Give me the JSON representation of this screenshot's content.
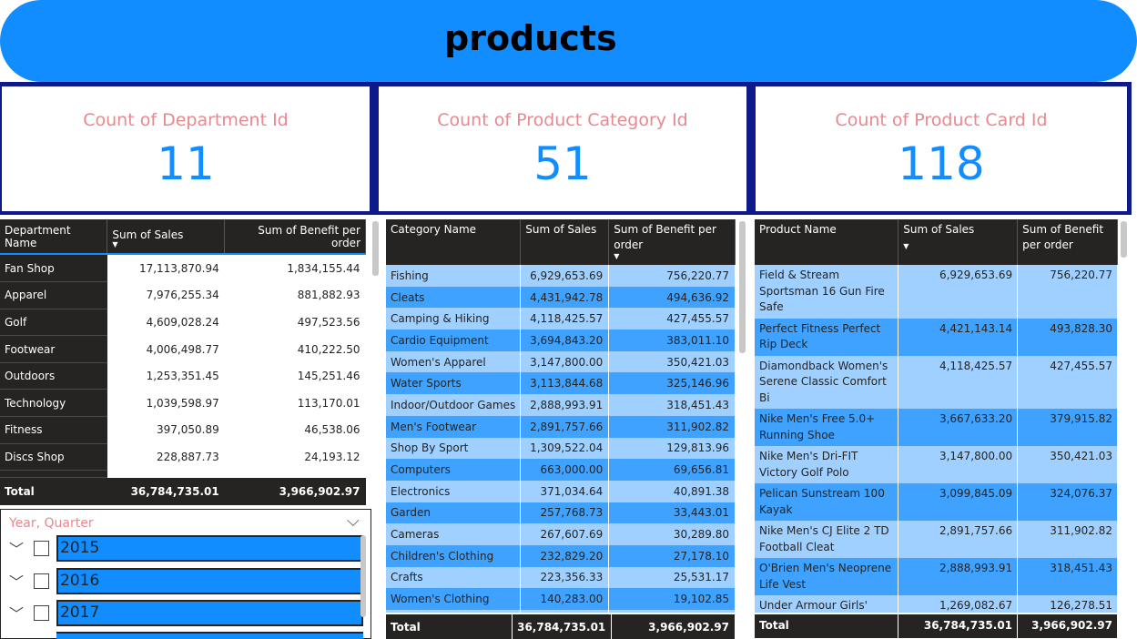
{
  "banner": {
    "title": "products"
  },
  "kpis": [
    {
      "label": "Count of Department Id",
      "value": "11"
    },
    {
      "label": "Count of Product Category Id",
      "value": "51"
    },
    {
      "label": "Count of Product Card Id",
      "value": "118"
    }
  ],
  "department_table": {
    "headers": [
      "Department Name",
      "Sum of Sales",
      "Sum of Benefit per order"
    ],
    "rows": [
      [
        "Fan Shop",
        "17,113,870.94",
        "1,834,155.44"
      ],
      [
        "Apparel",
        "7,976,255.34",
        "881,882.93"
      ],
      [
        "Golf",
        "4,609,028.24",
        "497,523.56"
      ],
      [
        "Footwear",
        "4,006,498.77",
        "410,222.50"
      ],
      [
        "Outdoors",
        "1,253,351.45",
        "145,251.46"
      ],
      [
        "Technology",
        "1,039,598.97",
        "113,170.01"
      ],
      [
        "Fitness",
        "397,050.89",
        "46,538.06"
      ],
      [
        "Discs Shop",
        "228,887.73",
        "24,193.12"
      ]
    ],
    "total": [
      "Total",
      "36,784,735.01",
      "3,966,902.97"
    ]
  },
  "category_table": {
    "headers": [
      "Category Name",
      "Sum of Sales",
      "Sum of Benefit per order"
    ],
    "rows": [
      [
        "Fishing",
        "6,929,653.69",
        "756,220.77"
      ],
      [
        "Cleats",
        "4,431,942.78",
        "494,636.92"
      ],
      [
        "Camping & Hiking",
        "4,118,425.57",
        "427,455.57"
      ],
      [
        "Cardio Equipment",
        "3,694,843.20",
        "383,011.10"
      ],
      [
        "Women's Apparel",
        "3,147,800.00",
        "350,421.03"
      ],
      [
        "Water Sports",
        "3,113,844.68",
        "325,146.96"
      ],
      [
        "Indoor/Outdoor Games",
        "2,888,993.91",
        "318,451.43"
      ],
      [
        "Men's Footwear",
        "2,891,757.66",
        "311,902.82"
      ],
      [
        "Shop By Sport",
        "1,309,522.04",
        "129,813.96"
      ],
      [
        "Computers",
        "663,000.00",
        "69,656.81"
      ],
      [
        "Electronics",
        "371,034.64",
        "40,891.38"
      ],
      [
        "Garden",
        "257,768.73",
        "33,443.01"
      ],
      [
        "Cameras",
        "267,607.69",
        "30,289.80"
      ],
      [
        "Children's Clothing",
        "232,829.20",
        "27,178.10"
      ],
      [
        "Crafts",
        "223,356.33",
        "25,531.17"
      ],
      [
        "Women's Clothing",
        "140,283.00",
        "19,102.85"
      ]
    ],
    "total": [
      "Total",
      "36,784,735.01",
      "3,966,902.97"
    ]
  },
  "product_table": {
    "headers": [
      "Product Name",
      "Sum of Sales",
      "Sum of Benefit per order"
    ],
    "rows": [
      [
        "Field & Stream Sportsman 16 Gun Fire Safe",
        "6,929,653.69",
        "756,220.77"
      ],
      [
        "Perfect Fitness Perfect Rip Deck",
        "4,421,143.14",
        "493,828.30"
      ],
      [
        "Diamondback Women's Serene Classic Comfort Bi",
        "4,118,425.57",
        "427,455.57"
      ],
      [
        "Nike Men's Free 5.0+ Running Shoe",
        "3,667,633.20",
        "379,915.82"
      ],
      [
        "Nike Men's Dri-FIT Victory Golf Polo",
        "3,147,800.00",
        "350,421.03"
      ],
      [
        "Pelican Sunstream 100 Kayak",
        "3,099,845.09",
        "324,076.37"
      ],
      [
        "Nike Men's CJ Elite 2 TD Football Cleat",
        "2,891,757.66",
        "311,902.82"
      ],
      [
        "O'Brien Men's Neoprene Life Vest",
        "2,888,993.91",
        "318,451.43"
      ],
      [
        "Under Armour Girls'",
        "1,269,082.67",
        "126,278.51"
      ]
    ],
    "total": [
      "Total",
      "36,784,735.01",
      "3,966,902.97"
    ]
  },
  "slicer": {
    "title": "Year, Quarter",
    "items": [
      "2015",
      "2016",
      "2017"
    ]
  },
  "colors": {
    "accent": "#118DFF",
    "kpi_label": "#E8888F",
    "table_dark": "#252423",
    "row_light": "#9FD0FF",
    "row_dark": "#3FA2FF",
    "kpi_frame": "#0E1A8A"
  }
}
